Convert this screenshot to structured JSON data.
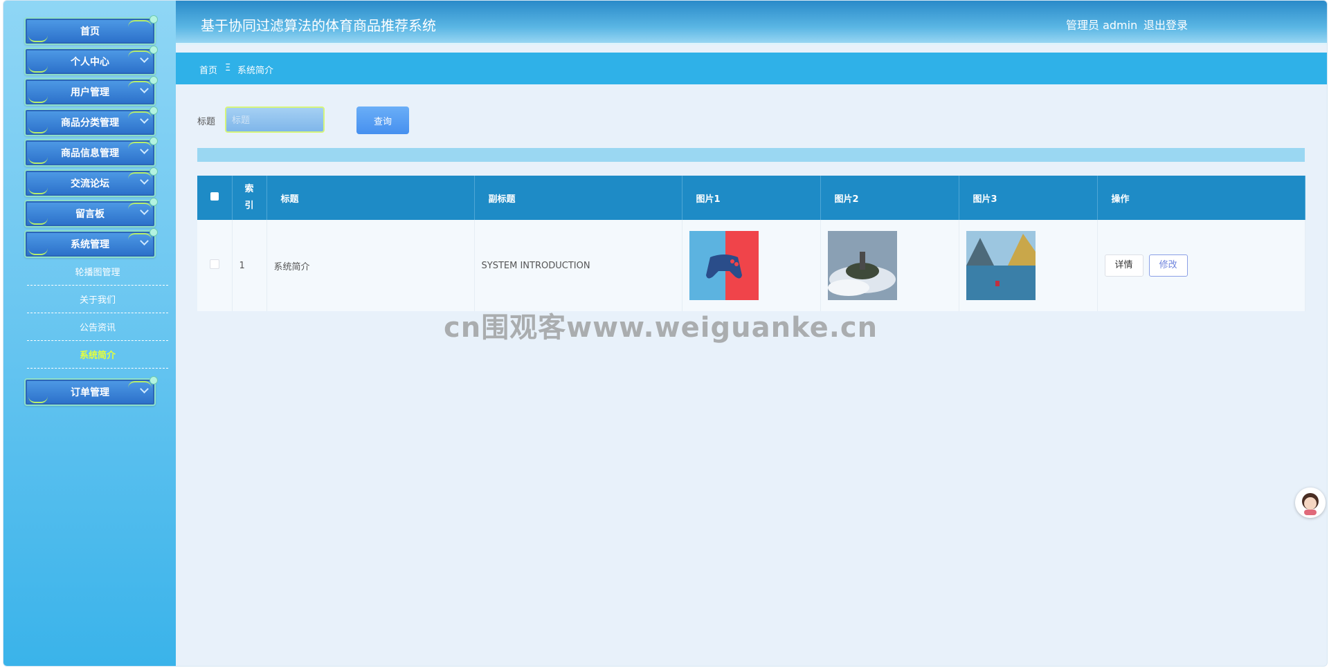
{
  "header": {
    "title": "基于协同过滤算法的体育商品推荐系统",
    "user": "管理员 admin",
    "logout": "退出登录"
  },
  "breadcrumb": {
    "home": "首页",
    "separator": "Ξ",
    "current": "系统简介"
  },
  "sidebar": {
    "menus": [
      "首页",
      "个人中心",
      "用户管理",
      "商品分类管理",
      "商品信息管理",
      "交流论坛",
      "留言板",
      "系统管理"
    ],
    "submenu": [
      "轮播图管理",
      "关于我们",
      "公告资讯",
      "系统简介"
    ],
    "active_submenu": "系统简介",
    "after_menus": [
      "订单管理"
    ]
  },
  "search": {
    "label": "标题",
    "placeholder": "标题",
    "button": "查询"
  },
  "table": {
    "headers": [
      "",
      "索引",
      "标题",
      "副标题",
      "图片1",
      "图片2",
      "图片3",
      "操作"
    ],
    "index_header_line1": "索",
    "index_header_line2": "引",
    "rows": [
      {
        "index": "1",
        "title": "系统简介",
        "subtitle": "SYSTEM INTRODUCTION",
        "image1": "game-controller-image",
        "image2": "floating-castle-image",
        "image3": "mountain-lake-image",
        "detail": "详情",
        "edit": "修改"
      }
    ]
  },
  "watermark": "cn围观客www.weiguanke.cn",
  "colors": {
    "header_top": "#2a8ac9",
    "crumb_bar": "#2fb1e8",
    "table_header": "#1e8bc6",
    "active_sub": "#e5ff3c"
  }
}
